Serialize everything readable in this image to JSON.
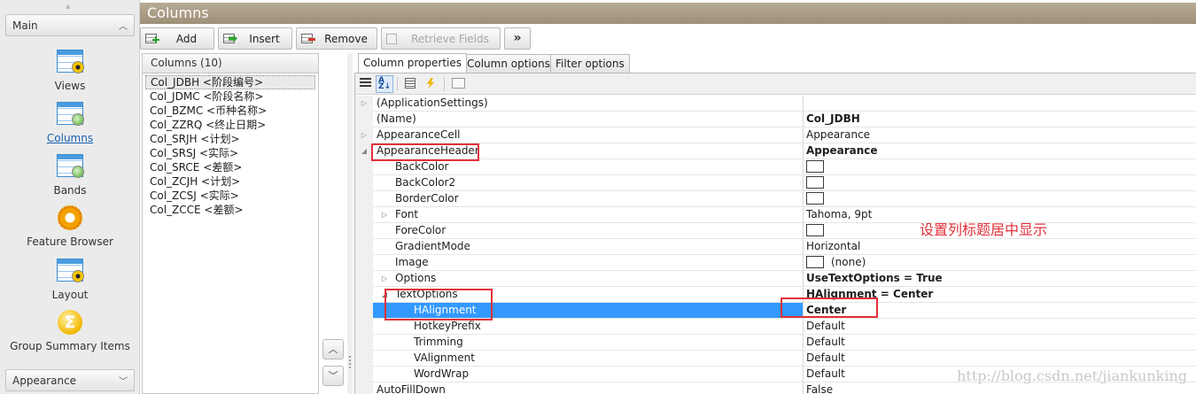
{
  "nav": {
    "groups": [
      "Main",
      "Appearance"
    ],
    "items": [
      {
        "label": "Views",
        "icon": "views-icon"
      },
      {
        "label": "Columns",
        "icon": "columns-icon"
      },
      {
        "label": "Bands",
        "icon": "bands-icon"
      },
      {
        "label": "Feature Browser",
        "icon": "feature-browser-icon"
      },
      {
        "label": "Layout",
        "icon": "layout-icon"
      },
      {
        "label": "Group Summary Items",
        "icon": "group-summary-icon"
      }
    ],
    "active_item": "Columns"
  },
  "header": {
    "title": "Columns"
  },
  "toolbar": {
    "add_label": "Add",
    "insert_label": "Insert",
    "remove_label": "Remove",
    "retrieve_label": "Retrieve Fields",
    "more_label": "»"
  },
  "columns_list": {
    "title": "Columns (10)",
    "items": [
      "Col_JDBH <阶段编号>",
      "Col_JDMC <阶段名称>",
      "Col_BZMC <币种名称>",
      "Col_ZZRQ <终止日期>",
      "Col_SRJH <计划>",
      "Col_SRSJ <实际>",
      "Col_SRCE <差额>",
      "Col_ZCJH <计划>",
      "Col_ZCSJ <实际>",
      "Col_ZCCE <差额>"
    ]
  },
  "tabs": [
    "Column properties",
    "Column options",
    "Filter options"
  ],
  "properties": [
    {
      "name": "(ApplicationSettings)",
      "value": "",
      "exp": "▷",
      "bold": false
    },
    {
      "name": "(Name)",
      "value": "Col_JDBH",
      "exp": "",
      "bold": true
    },
    {
      "name": "AppearanceCell",
      "value": "Appearance",
      "exp": "▷",
      "bold": false
    },
    {
      "name": "AppearanceHeader",
      "value": "Appearance",
      "exp": "◢",
      "bold": true
    },
    {
      "name": "BackColor",
      "value": "",
      "exp": "",
      "bold": false
    },
    {
      "name": "BackColor2",
      "value": "",
      "exp": "",
      "bold": false
    },
    {
      "name": "BorderColor",
      "value": "",
      "exp": "",
      "bold": false
    },
    {
      "name": "Font",
      "value": "Tahoma, 9pt",
      "exp": "▷",
      "bold": false
    },
    {
      "name": "ForeColor",
      "value": "",
      "exp": "",
      "bold": false
    },
    {
      "name": "GradientMode",
      "value": "Horizontal",
      "exp": "",
      "bold": false
    },
    {
      "name": "Image",
      "value": "(none)",
      "exp": "",
      "bold": false
    },
    {
      "name": "Options",
      "value": "UseTextOptions = True",
      "exp": "▷",
      "bold": true
    },
    {
      "name": "TextOptions",
      "value": "HAlignment = Center",
      "exp": "◢",
      "bold": true
    },
    {
      "name": "HAlignment",
      "value": "Center",
      "exp": "",
      "bold": true
    },
    {
      "name": "HotkeyPrefix",
      "value": "Default",
      "exp": "",
      "bold": false
    },
    {
      "name": "Trimming",
      "value": "Default",
      "exp": "",
      "bold": false
    },
    {
      "name": "VAlignment",
      "value": "Default",
      "exp": "",
      "bold": false
    },
    {
      "name": "WordWrap",
      "value": "Default",
      "exp": "",
      "bold": false
    },
    {
      "name": "AutoFillDown",
      "value": "False",
      "exp": "",
      "bold": false
    }
  ],
  "annotation": "设置列标题居中显示",
  "watermark": "http://blog.csdn.net/jiankunking",
  "colors": {
    "header_bg": "#a89b84",
    "selection": "#3399ff",
    "callout": "#e3303a"
  }
}
